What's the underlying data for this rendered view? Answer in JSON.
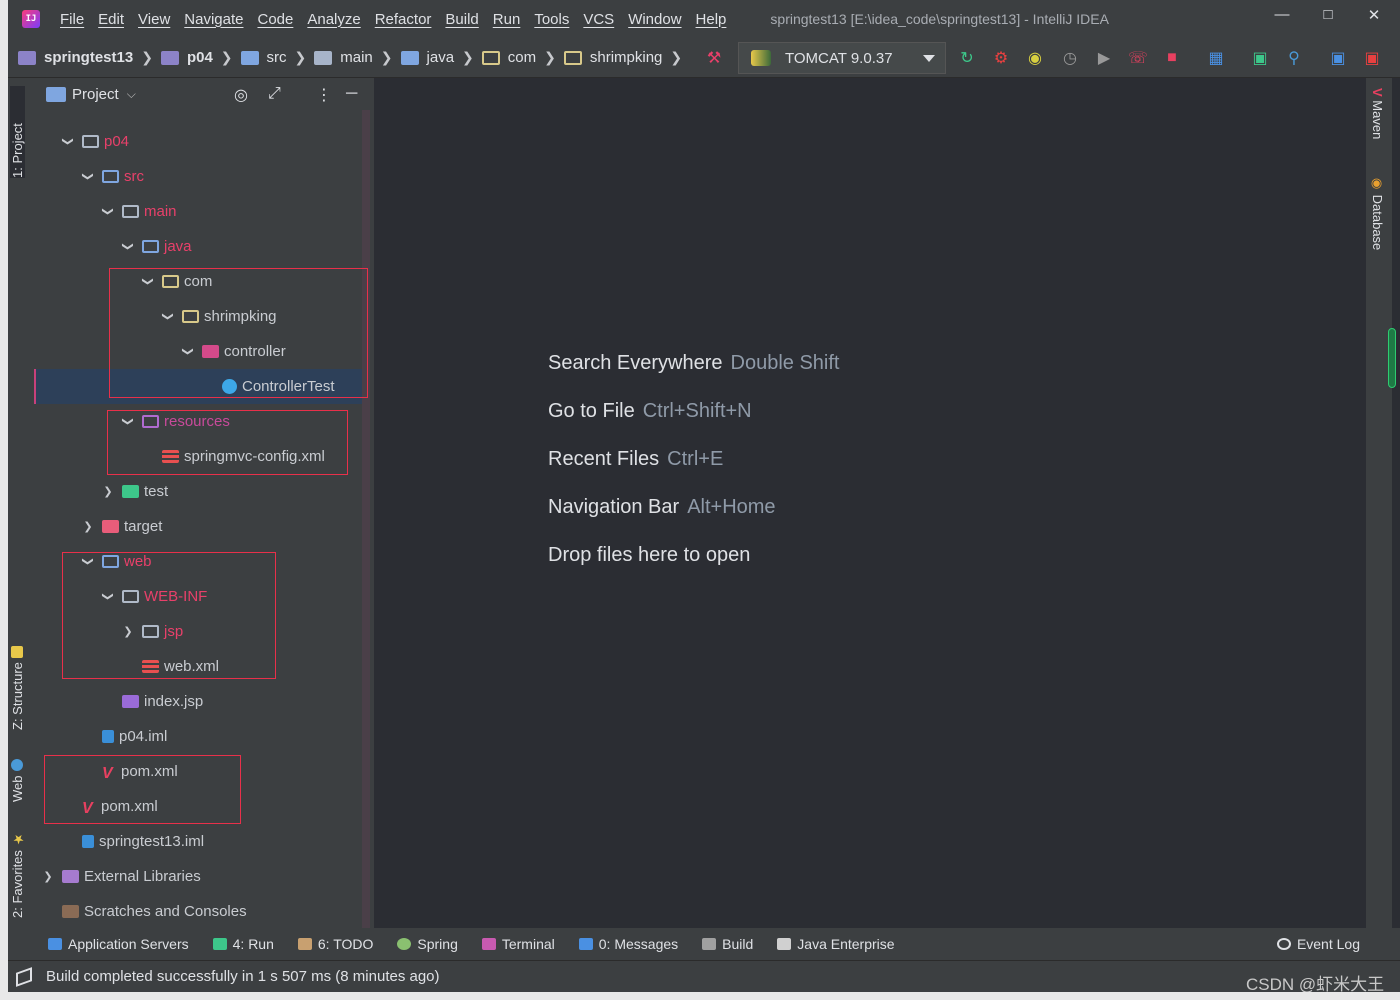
{
  "menu": {
    "items": [
      "File",
      "Edit",
      "View",
      "Navigate",
      "Code",
      "Analyze",
      "Refactor",
      "Build",
      "Run",
      "Tools",
      "VCS",
      "Window",
      "Help"
    ],
    "window_title": "springtest13 [E:\\idea_code\\springtest13] - IntelliJ IDEA"
  },
  "breadcrumb": [
    "springtest13",
    "p04",
    "src",
    "main",
    "java",
    "com",
    "shrimpking"
  ],
  "run_config": "TOMCAT 9.0.37",
  "project_panel": {
    "title": "Project",
    "tree": [
      {
        "label": "p04"
      },
      {
        "label": "src"
      },
      {
        "label": "main"
      },
      {
        "label": "java"
      },
      {
        "label": "com"
      },
      {
        "label": "shrimpking"
      },
      {
        "label": "controller"
      },
      {
        "label": "ControllerTest"
      },
      {
        "label": "resources"
      },
      {
        "label": "springmvc-config.xml"
      },
      {
        "label": "test"
      },
      {
        "label": "target"
      },
      {
        "label": "web"
      },
      {
        "label": "WEB-INF"
      },
      {
        "label": "jsp"
      },
      {
        "label": "web.xml"
      },
      {
        "label": "index.jsp"
      },
      {
        "label": "p04.iml"
      },
      {
        "label": "pom.xml"
      },
      {
        "label": "pom.xml"
      },
      {
        "label": "springtest13.iml"
      },
      {
        "label": "External Libraries"
      },
      {
        "label": "Scratches and Consoles"
      }
    ]
  },
  "left_tabs": [
    "1: Project",
    "Z: Structure",
    "Web",
    "2: Favorites"
  ],
  "right_tabs": [
    "Maven",
    "Database"
  ],
  "editor_hints": [
    {
      "action": "Search Everywhere",
      "key": "Double Shift"
    },
    {
      "action": "Go to File",
      "key": "Ctrl+Shift+N"
    },
    {
      "action": "Recent Files",
      "key": "Ctrl+E"
    },
    {
      "action": "Navigation Bar",
      "key": "Alt+Home"
    },
    {
      "action": "Drop files here to open",
      "key": ""
    }
  ],
  "bottom_tools": [
    {
      "label": "Application Servers"
    },
    {
      "label": "4: Run"
    },
    {
      "label": "6: TODO"
    },
    {
      "label": "Spring"
    },
    {
      "label": "Terminal"
    },
    {
      "label": "0: Messages"
    },
    {
      "label": "Build"
    },
    {
      "label": "Java Enterprise"
    }
  ],
  "event_log": "Event Log",
  "status_text": "Build completed successfully in 1 s 507 ms (8 minutes ago)",
  "watermark": "CSDN @虾米大王",
  "colors": {
    "accent_red": "#e8406a",
    "selection": "#2d4059",
    "highlight_box": "#e8304a"
  }
}
